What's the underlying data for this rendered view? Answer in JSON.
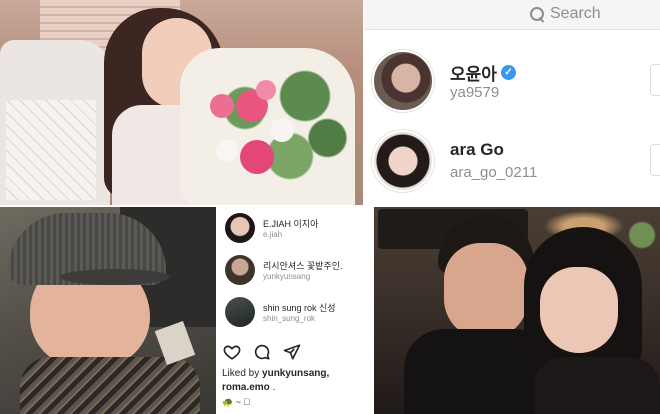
{
  "search": {
    "placeholder": "Search",
    "results": [
      {
        "name": "오윤아",
        "verified": true,
        "handle": "ya9579"
      },
      {
        "name": "ara Go",
        "verified": false,
        "handle": "ara_go_0211"
      }
    ]
  },
  "post": {
    "accounts": [
      {
        "name": "E.JIAH 이지아",
        "sub": "e.jiah"
      },
      {
        "name": "리시안셔스 꽃밭주인.",
        "sub": "yunkyunsang"
      },
      {
        "name": "shin sung rok 신성",
        "sub": "shin_sung_rok"
      }
    ],
    "liked_prefix": "Liked by",
    "liked_user1": "yunkyunsang,",
    "liked_user2": "roma.emo",
    "liked_suffix": ".",
    "caption": "🐢 ~ 🏼"
  },
  "icons": {
    "verified": "check-badge",
    "search": "magnifier",
    "like": "heart-outline",
    "comment": "speech-bubble",
    "share": "paper-plane"
  },
  "colors": {
    "verified_blue": "#3897f0",
    "muted_text": "#8e8e8e",
    "search_bg": "#f5f5f5"
  }
}
